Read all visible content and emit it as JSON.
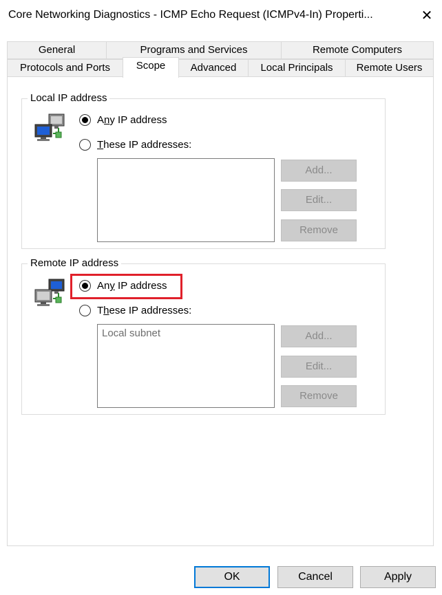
{
  "window": {
    "title": "Core Networking Diagnostics - ICMP Echo Request (ICMPv4-In) Properti...",
    "close_label": "✕"
  },
  "tabs_row1": [
    "General",
    "Programs and Services",
    "Remote Computers"
  ],
  "tabs_row2": [
    "Protocols and Ports",
    "Scope",
    "Advanced",
    "Local Principals",
    "Remote Users"
  ],
  "active_tab": "Scope",
  "local_ip": {
    "legend": "Local IP address",
    "any_prefix": "A",
    "any_u": "n",
    "any_rest": "y IP address",
    "these_u": "T",
    "these_rest": "hese IP addresses:",
    "selected": "any",
    "list_items": [],
    "add": "Add...",
    "edit": "Edit...",
    "remove": "Remove"
  },
  "remote_ip": {
    "legend": "Remote IP address",
    "any_prefix": "An",
    "any_u": "y",
    "any_rest": " IP address",
    "these_u": "h",
    "these_prefix": "T",
    "these_rest": "ese IP addresses:",
    "selected": "any",
    "list_items": [
      "Local subnet"
    ],
    "add": "Add...",
    "edit": "Edit...",
    "remove": "Remove"
  },
  "buttons": {
    "ok": "OK",
    "cancel": "Cancel",
    "apply": "Apply"
  },
  "colors": {
    "highlight": "#e0202a",
    "default_button_border": "#0078d7"
  }
}
